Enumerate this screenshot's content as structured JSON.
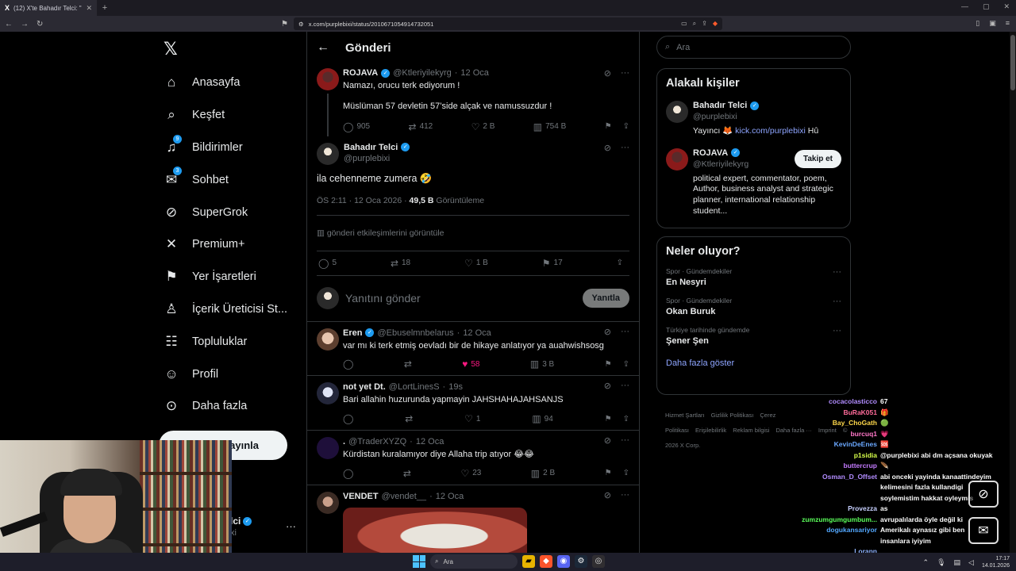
{
  "browser": {
    "tab_title": "(12) X'te Bahadır Telci: \"@Ktleriy...",
    "url": "x.com/purplebixi/status/2010671054914732051"
  },
  "nav": {
    "items": [
      {
        "label": "Anasayfa",
        "icon": "home-icon",
        "glyph": "⌂"
      },
      {
        "label": "Keşfet",
        "icon": "search-icon",
        "glyph": "⌕"
      },
      {
        "label": "Bildirimler",
        "icon": "bell-icon",
        "glyph": "♫",
        "badge": "9"
      },
      {
        "label": "Sohbet",
        "icon": "mail-icon",
        "glyph": "✉",
        "badge": "3"
      },
      {
        "label": "SuperGrok",
        "icon": "grok-icon",
        "glyph": "⊘"
      },
      {
        "label": "Premium+",
        "icon": "x-icon",
        "glyph": "✕"
      },
      {
        "label": "Yer İşaretleri",
        "icon": "bookmark-icon",
        "glyph": "⚑"
      },
      {
        "label": "İçerik Üreticisi St...",
        "icon": "creator-studio-icon",
        "glyph": "♙"
      },
      {
        "label": "Topluluklar",
        "icon": "communities-icon",
        "glyph": "☷"
      },
      {
        "label": "Profil",
        "icon": "profile-icon",
        "glyph": "☺"
      },
      {
        "label": "Daha fazla",
        "icon": "more-circle-icon",
        "glyph": "⊙"
      }
    ],
    "post_button": "ayınla",
    "account_name": "lci",
    "account_handle": "xi"
  },
  "post": {
    "back": "←",
    "title": "Gönderi",
    "parent": {
      "name": "ROJAVA",
      "handle": "@Ktleriyilekyrg",
      "time": "12 Oca",
      "line1": "Namazı, orucu terk ediyorum !",
      "line2": "Müslüman 57 devletin 57’side alçak ve namussuzdur !",
      "replies": "905",
      "reposts": "412",
      "likes": "2 B",
      "views": "754 B"
    },
    "main": {
      "name": "Bahadır Telci",
      "handle": "@purplebixi",
      "text": "ila cehenneme zumera 🤣",
      "meta_time": "ÖS 2:11 · 12 Oca 2026 · ",
      "views_count": "49,5 B",
      "views_label": " Görüntüleme",
      "engagements": "gönderi etkileşimlerini görüntüle",
      "replies": "5",
      "reposts": "18",
      "likes": "1 B",
      "bookmarks": "17"
    },
    "reply_placeholder": "Yanıtını gönder",
    "reply_button": "Yanıtla"
  },
  "replies": [
    {
      "name": "Eren",
      "verified": true,
      "handle": "@Ebuselmnbelarus",
      "time": "12 Oca",
      "text": "var mı ki terk etmiş oevladı bir de hikaye anlatıyor ya auahwishsosg",
      "replies": "",
      "reposts": "",
      "likes": "58",
      "liked": true,
      "views": "3 B",
      "avatar": "av-face"
    },
    {
      "name": "not yet Dt.",
      "verified": false,
      "handle": "@LortLinesS",
      "time": "19s",
      "text": "Bari allahin huzurunda yapmayin JAHSHAHAJAHSANJS",
      "replies": "",
      "reposts": "",
      "likes": "1",
      "liked": false,
      "views": "94",
      "avatar": "av-anime"
    },
    {
      "name": ".",
      "verified": false,
      "handle": "@TraderXYZQ",
      "time": "12 Oca",
      "text": "Kürdistan kuralamıyor diye Allaha trip atıyor 😂😂",
      "replies": "",
      "reposts": "",
      "likes": "23",
      "liked": false,
      "views": "2 B",
      "avatar": "av-purple"
    },
    {
      "name": "VENDET",
      "verified": false,
      "handle": "@vendet__",
      "time": "12 Oca",
      "text": "",
      "replies": "",
      "reposts": "",
      "likes": "",
      "liked": false,
      "views": "",
      "avatar": "av-vendet"
    }
  ],
  "sidebar": {
    "search_placeholder": "Ara",
    "related_title": "Alakalı kişiler",
    "people": [
      {
        "name": "Bahadır Telci",
        "handle": "@purplebixi",
        "bio_pre": "Yayıncı 🦊 ",
        "bio_link": "kick.com/purplebixi",
        "bio_post": " Hû"
      },
      {
        "name": "ROJAVA",
        "handle": "@Ktleriyilekyrg",
        "bio": "political expert, commentator, poem, Author, business analyst and strategic planner, international relationship student...",
        "follow": "Takip et"
      }
    ],
    "trends_title": "Neler oluyor?",
    "trends": [
      {
        "category": "Spor · Gündemdekiler",
        "name": "En Nesyri"
      },
      {
        "category": "Spor · Gündemdekiler",
        "name": "Okan Buruk"
      },
      {
        "category": "Türkiye tarihinde gündemde",
        "name": "Şener Şen"
      }
    ],
    "show_more": "Daha fazla göster",
    "footer": [
      "Hizmet Şartları",
      "Gizlilik Politikası",
      "Çerez Politikası",
      "Erişilebilirlik",
      "Reklam bilgisi",
      "Daha fazla ···",
      "Imprint",
      "© 2026 X Corp."
    ]
  },
  "chat": [
    {
      "user": "cocacolasticco",
      "msg": "67",
      "color": "#b18cff"
    },
    {
      "user": "BuRaK051",
      "msg": "🎁",
      "color": "#ff6b9a"
    },
    {
      "user": "Bay_ChoGath",
      "msg": "🟢",
      "color": "#ffd84a"
    },
    {
      "user": "burcuq1",
      "msg": "💗",
      "color": "#ff77c8"
    },
    {
      "user": "KevinDeEnes",
      "msg": "🆘",
      "color": "#6aa8ff"
    },
    {
      "user": "p1sidia",
      "msg": "@purplebixi abi dm açsana okuyak",
      "color": "#d7ff4a"
    },
    {
      "user": "buttercrup",
      "msg": "🪶",
      "color": "#c47bff"
    },
    {
      "user": "Osman_D_Offset",
      "msg": "abi onceki yayinda kanaattindeyim",
      "color": "#b28cff"
    },
    {
      "user": "",
      "msg": "kelimesini fazla kullandigi",
      "color": "#fff"
    },
    {
      "user": "",
      "msg": "soylemistim hakkat oyleymis",
      "color": "#fff"
    },
    {
      "user": "Provezza",
      "msg": "as",
      "color": "#c7d0ff"
    },
    {
      "user": "zumzumgumgumbum...",
      "msg": "avrupalılarda öyle değil ki",
      "color": "#5bff5b"
    },
    {
      "user": "dogukansariyor",
      "msg": "Amerikalı aynasız gibi ben",
      "color": "#53a8ff"
    },
    {
      "user": "",
      "msg": "insanlara iyiyim",
      "color": "#fff"
    },
    {
      "user": "Lorann",
      "msg": "",
      "color": "#8fb3ff"
    }
  ],
  "taskbar": {
    "search": "Ara",
    "time": "17:17",
    "date": "14.01.2026"
  },
  "colors": {
    "accent": "#1d9bf0",
    "like": "#f91880",
    "link": "#8ea5ff",
    "bg": "#000000",
    "border": "#2f3336"
  }
}
